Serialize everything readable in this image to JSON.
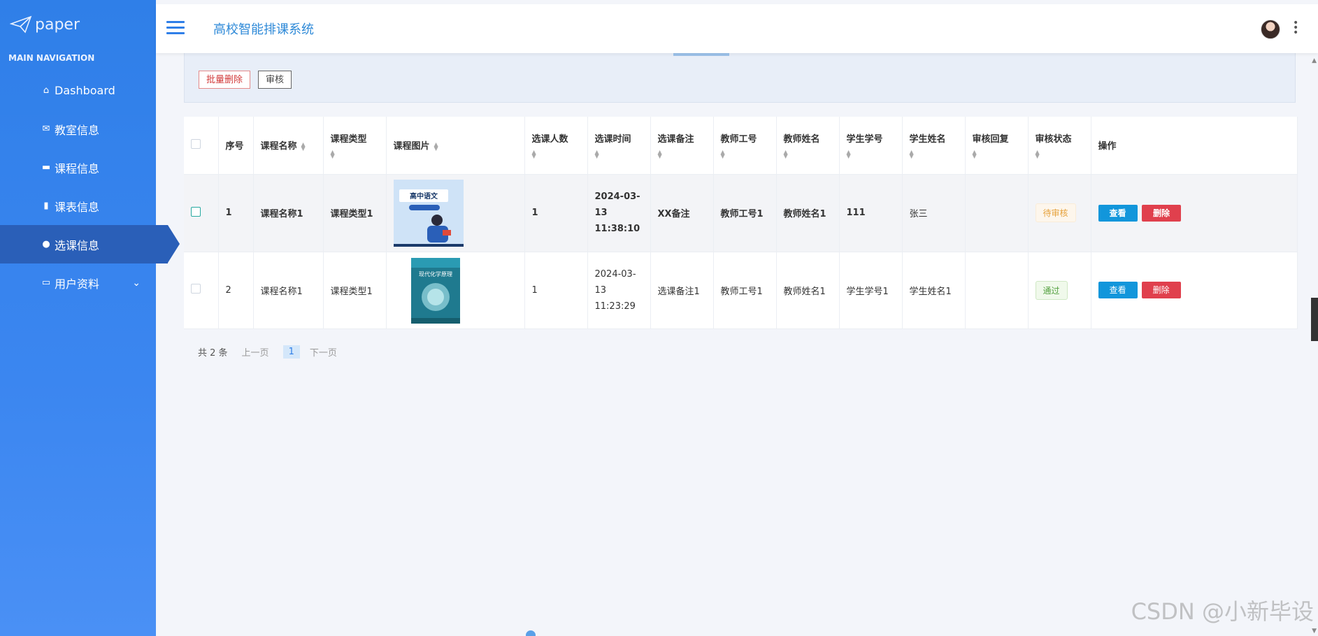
{
  "brand": {
    "name": "paper"
  },
  "nav": {
    "header": "MAIN NAVIGATION",
    "items": [
      {
        "label": "Dashboard",
        "icon": "home-icon"
      },
      {
        "label": "教室信息",
        "icon": "envelope-icon"
      },
      {
        "label": "课程信息",
        "icon": "briefcase-icon"
      },
      {
        "label": "课表信息",
        "icon": "clipboard-icon"
      },
      {
        "label": "选课信息",
        "icon": "user-icon",
        "active": true
      },
      {
        "label": "用户资料",
        "icon": "card-icon",
        "expandable": true
      }
    ]
  },
  "header": {
    "title": "高校智能排课系统"
  },
  "toolbar": {
    "batch_delete": "批量删除",
    "audit": "审核"
  },
  "table": {
    "columns": [
      "序号",
      "课程名称",
      "课程类型",
      "课程图片",
      "选课人数",
      "选课时间",
      "选课备注",
      "教师工号",
      "教师姓名",
      "学生学号",
      "学生姓名",
      "审核回复",
      "审核状态",
      "操作"
    ],
    "rows": [
      {
        "index": "1",
        "course_name": "课程名称1",
        "course_type": "课程类型1",
        "image_title": "高中语文",
        "enroll_count": "1",
        "time": "2024-03-13 11:38:10",
        "remark": "XX备注",
        "teacher_id": "教师工号1",
        "teacher_name": "教师姓名1",
        "student_id": "111",
        "student_name": "张三",
        "reply": "",
        "status": "待审核",
        "view": "查看",
        "delete": "删除"
      },
      {
        "index": "2",
        "course_name": "课程名称1",
        "course_type": "课程类型1",
        "image_title": "现代化学原理",
        "enroll_count": "1",
        "time": "2024-03-13 11:23:29",
        "remark": "选课备注1",
        "teacher_id": "教师工号1",
        "teacher_name": "教师姓名1",
        "student_id": "学生学号1",
        "student_name": "学生姓名1",
        "reply": "",
        "status": "通过",
        "view": "查看",
        "delete": "删除"
      }
    ]
  },
  "pager": {
    "total": "共 2 条",
    "prev": "上一页",
    "current": "1",
    "next": "下一页"
  },
  "watermark": "CSDN @小新毕设",
  "colors": {
    "sidebar": "#2f7fe8",
    "view_button": "#1296db",
    "delete_button": "#e0404d"
  }
}
